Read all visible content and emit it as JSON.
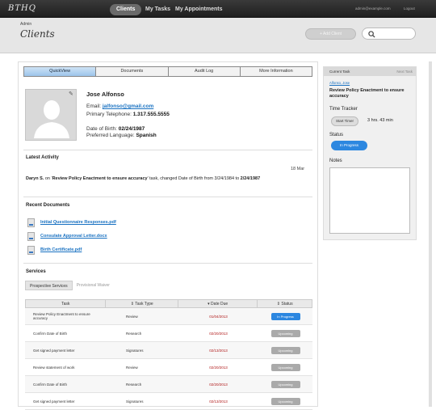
{
  "topbar": {
    "logo": "BTHQ",
    "nav": [
      "Clients",
      "My Tasks",
      "My Appointments"
    ],
    "email": "admin@example.com",
    "logout": "Logout"
  },
  "header": {
    "admin": "Admin",
    "title": "Clients",
    "button": "+ Add Client",
    "search_placeholder": ""
  },
  "tabs": [
    "QuickView",
    "Documents",
    "Audit Log",
    "More Information"
  ],
  "profile": {
    "name": "Jose Alfonso",
    "email_label": "Email:",
    "email": "jalfonso@gmail.com",
    "phone_label": "Primary Telephone:",
    "phone": "1.317.555.5555",
    "dob_label": "Date of Birth:",
    "dob": "02/24/1987",
    "lang_label": "Preferred Language:",
    "lang": "Spanish"
  },
  "activity": {
    "title": "Latest Activity",
    "date": "18 Mar",
    "who": "Daryn S.",
    "pre": " on '",
    "task": "Review Policy Enactment to ensure accuracy",
    "post": "' task, changed Date of Birth from 3/24/1984 to ",
    "newdob": "2/24/1987"
  },
  "documents": {
    "title": "Recent Documents",
    "items": [
      "Initial Questionnaire Responses.pdf",
      "Consulate Approval Letter.docx",
      "Birth Certificate.pdf"
    ]
  },
  "services": {
    "title": "Services",
    "tabs": [
      "Prospective Services",
      "Provisional Waiver"
    ]
  },
  "table": {
    "headers": [
      "Task",
      "Task Type",
      "Date Due",
      "Status"
    ],
    "rows": [
      {
        "task": "Review Policy Enactment to ensure accuracy",
        "type": "Review",
        "due": "01/04/2013",
        "status": "In Progress"
      },
      {
        "task": "Confirm Date of Birth",
        "type": "Research",
        "due": "02/20/2013",
        "status": "Upcoming"
      },
      {
        "task": "Get signed payment letter",
        "type": "Signatures",
        "due": "02/13/2013",
        "status": "Upcoming"
      },
      {
        "task": "Review statement of work",
        "type": "Review",
        "due": "02/20/2013",
        "status": "Upcoming"
      },
      {
        "task": "Confirm Date of Birth",
        "type": "Research",
        "due": "02/20/2013",
        "status": "Upcoming"
      },
      {
        "task": "Get signed payment letter",
        "type": "Signatures",
        "due": "02/13/2013",
        "status": "Upcoming"
      }
    ]
  },
  "sidebar": {
    "title": "Current Task",
    "next": "Next Task",
    "assignee": "Alfonso, Jose",
    "task": "Review Policy Enactment to ensure accuracy",
    "tracker": "Time Tracker",
    "start": "Start Timer",
    "elapsed": "3 hrs. 43 min",
    "status_label": "Status",
    "status": "In Progress",
    "notes": "Notes"
  },
  "colors": {
    "accent": "#2c87e0",
    "link": "#1a72c2",
    "due": "#b01818"
  }
}
